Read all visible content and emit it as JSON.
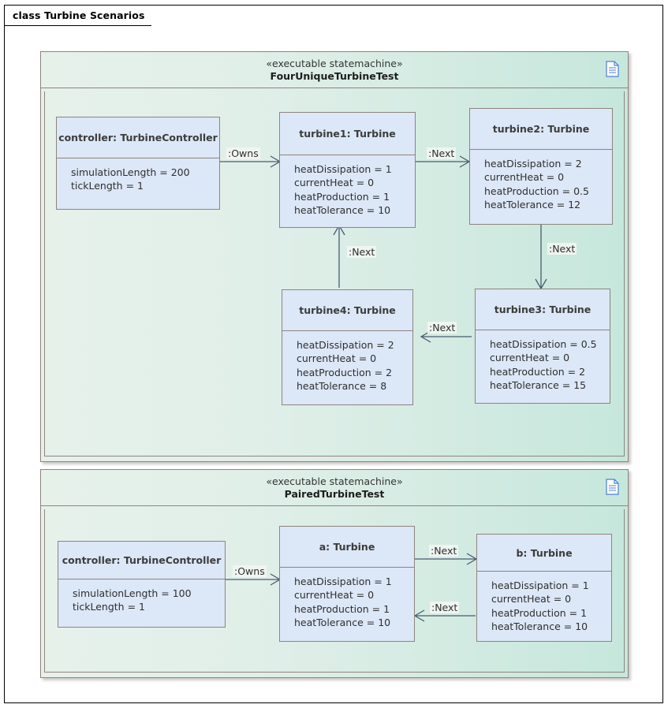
{
  "frame": {
    "label": "class Turbine Scenarios"
  },
  "packages": [
    {
      "id": "four-unique-turbine-test",
      "stereotype": "«executable statemachine»",
      "name": "FourUniqueTurbineTest",
      "icon": "document-icon",
      "classes": [
        {
          "id": "controller-1",
          "title": "controller: TurbineController",
          "attributes": [
            "simulationLength = 200",
            "tickLength = 1"
          ]
        },
        {
          "id": "turbine1",
          "title": "turbine1: Turbine",
          "attributes": [
            "heatDissipation = 1",
            "currentHeat = 0",
            "heatProduction = 1",
            "heatTolerance = 10"
          ]
        },
        {
          "id": "turbine2",
          "title": "turbine2: Turbine",
          "attributes": [
            "heatDissipation = 2",
            "currentHeat = 0",
            "heatProduction = 0.5",
            "heatTolerance = 12"
          ]
        },
        {
          "id": "turbine3",
          "title": "turbine3: Turbine",
          "attributes": [
            "heatDissipation = 0.5",
            "currentHeat = 0",
            "heatProduction = 2",
            "heatTolerance = 15"
          ]
        },
        {
          "id": "turbine4",
          "title": "turbine4: Turbine",
          "attributes": [
            "heatDissipation = 2",
            "currentHeat = 0",
            "heatProduction = 2",
            "heatTolerance = 8"
          ]
        }
      ],
      "connectors": [
        {
          "id": "owns-1",
          "label": ":Owns",
          "from": "controller-1",
          "to": "turbine1"
        },
        {
          "id": "next-1-2",
          "label": ":Next",
          "from": "turbine1",
          "to": "turbine2"
        },
        {
          "id": "next-2-3",
          "label": ":Next",
          "from": "turbine2",
          "to": "turbine3"
        },
        {
          "id": "next-3-4",
          "label": ":Next",
          "from": "turbine3",
          "to": "turbine4"
        },
        {
          "id": "next-4-1",
          "label": ":Next",
          "from": "turbine4",
          "to": "turbine1"
        }
      ]
    },
    {
      "id": "paired-turbine-test",
      "stereotype": "«executable statemachine»",
      "name": "PairedTurbineTest",
      "icon": "document-icon",
      "classes": [
        {
          "id": "controller-2",
          "title": "controller: TurbineController",
          "attributes": [
            "simulationLength = 100",
            "tickLength = 1"
          ]
        },
        {
          "id": "turbine-a",
          "title": "a: Turbine",
          "attributes": [
            "heatDissipation = 1",
            "currentHeat = 0",
            "heatProduction = 1",
            "heatTolerance = 10"
          ]
        },
        {
          "id": "turbine-b",
          "title": "b: Turbine",
          "attributes": [
            "heatDissipation = 1",
            "currentHeat = 0",
            "heatProduction = 1",
            "heatTolerance = 10"
          ]
        }
      ],
      "connectors": [
        {
          "id": "owns-2",
          "label": ":Owns",
          "from": "controller-2",
          "to": "turbine-a"
        },
        {
          "id": "next-a-b",
          "label": ":Next",
          "from": "turbine-a",
          "to": "turbine-b"
        },
        {
          "id": "next-b-a",
          "label": ":Next",
          "from": "turbine-b",
          "to": "turbine-a"
        }
      ]
    }
  ],
  "colors": {
    "package_border": "#8f837e",
    "package_fill_left": "#e6f1ea",
    "package_fill_right": "#c6e7dc",
    "class_fill": "#dce7f7",
    "class_border": "#8f837e",
    "connector": "#4a5a70",
    "frame_border": "#000000"
  }
}
